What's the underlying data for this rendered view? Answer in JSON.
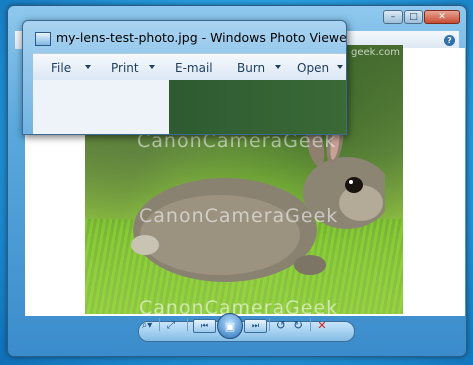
{
  "front_window": {
    "title": "my-lens-test-photo.jpg - Windows Photo Viewer",
    "menu": [
      {
        "label": "File",
        "has_dropdown": true
      },
      {
        "label": "Print",
        "has_dropdown": true
      },
      {
        "label": "E-mail",
        "has_dropdown": false
      },
      {
        "label": "Burn",
        "has_dropdown": true
      },
      {
        "label": "Open",
        "has_dropdown": true
      }
    ]
  },
  "viewer": {
    "caption_buttons": {
      "minimize": "–",
      "maximize": "□",
      "close": "✕"
    },
    "help_icon": "?",
    "photo": {
      "watermark": "CanonCameraGeek",
      "watermark_small": "geek.com"
    },
    "controls": {
      "zoom_icon": "⌕▾",
      "fit_icon": "⤢",
      "prev_icon": "⏮",
      "play_icon": "▣",
      "next_icon": "⏭",
      "rotate_left_icon": "↺",
      "rotate_right_icon": "↻",
      "delete_icon": "✕"
    }
  },
  "colors": {
    "accent": "#3b8ccc",
    "delete": "#cc2020"
  }
}
